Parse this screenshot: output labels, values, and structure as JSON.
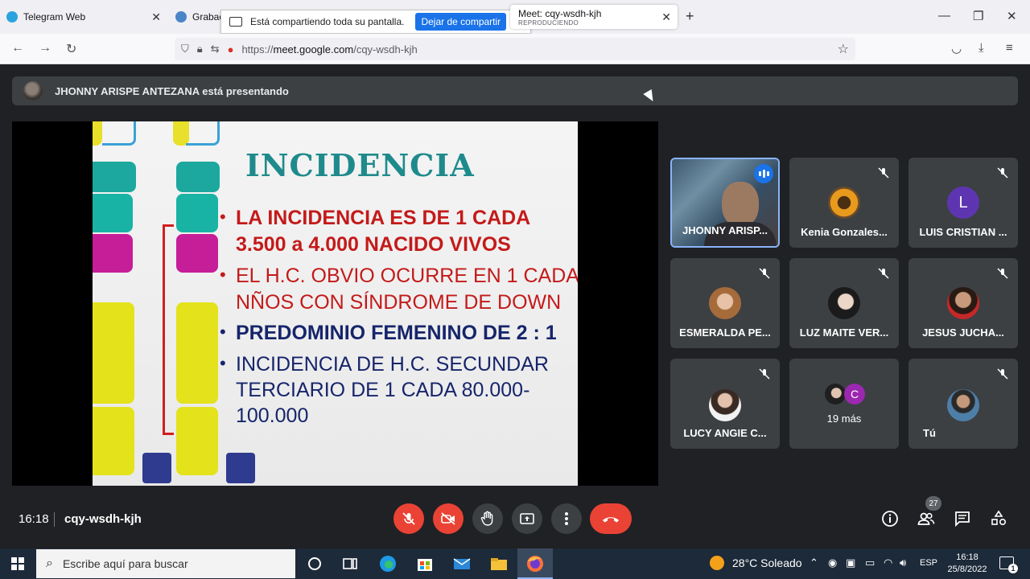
{
  "browser": {
    "tabs": [
      {
        "label": "Telegram Web",
        "icon": "telegram-icon"
      },
      {
        "label": "Grabac",
        "icon": "record-icon"
      },
      {
        "label": "Meet: cqy-wsdh-kjh",
        "sublabel": "REPRODUCIENDO",
        "icon": "meet-icon"
      }
    ],
    "share_bar": {
      "text": "Está compartiendo toda su pantalla.",
      "stop_label": "Dejar de compartir"
    },
    "url_prefix": "https://",
    "url_host": "meet.google.com",
    "url_path": "/cqy-wsdh-kjh"
  },
  "meet": {
    "presenter_banner": "JHONNY ARISPE ANTEZANA está presentando",
    "slide": {
      "title": "INCIDENCIA",
      "bullets": [
        {
          "lines": [
            "LA INCIDENCIA ES DE 1 CADA",
            "3.500 a 4.000 NACIDO VIVOS"
          ],
          "style": "red-bold"
        },
        {
          "lines": [
            "EL H.C. OBVIO OCURRE EN 1 CADA",
            "NÑOS CON SÍNDROME DE DOWN"
          ],
          "style": "red"
        },
        {
          "lines": [
            "PREDOMINIO FEMENINO DE 2 : 1"
          ],
          "style": "navy-bold"
        },
        {
          "lines": [
            "INCIDENCIA DE H.C. SECUNDAR",
            "TERCIARIO DE 1 CADA 80.000-",
            "100.000"
          ],
          "style": "navy"
        }
      ]
    },
    "participants": [
      {
        "name": "JHONNY ARISP...",
        "type": "video",
        "speaking": true
      },
      {
        "name": "Kenia Gonzales...",
        "type": "photo",
        "muted": true
      },
      {
        "name": "LUIS CRISTIAN ...",
        "type": "letter",
        "letter": "L",
        "muted": true
      },
      {
        "name": "ESMERALDA PE...",
        "type": "photo",
        "muted": true
      },
      {
        "name": "LUZ MAITE VER...",
        "type": "photo",
        "muted": true
      },
      {
        "name": "JESUS JUCHA...",
        "type": "photo",
        "muted": true
      },
      {
        "name": "LUCY ANGIE C...",
        "type": "photo",
        "muted": true
      },
      {
        "name": "19 más",
        "type": "more",
        "letter": "C"
      },
      {
        "name": "Tú",
        "type": "photo",
        "muted": true
      }
    ],
    "bottom": {
      "time": "16:18",
      "meeting_code": "cqy-wsdh-kjh",
      "people_count": "27"
    }
  },
  "taskbar": {
    "search_placeholder": "Escribe aquí para buscar",
    "weather": "28°C Soleado",
    "language": "ESP",
    "time": "16:18",
    "date": "25/8/2022",
    "notifications": "1"
  },
  "colors": {
    "meet_bg": "#202124",
    "tile_bg": "#3c4043",
    "danger": "#ea4335",
    "accent": "#1a73e8",
    "slide_title": "#1f8a8c",
    "slide_red": "#c41a1a",
    "slide_navy": "#16256b"
  }
}
